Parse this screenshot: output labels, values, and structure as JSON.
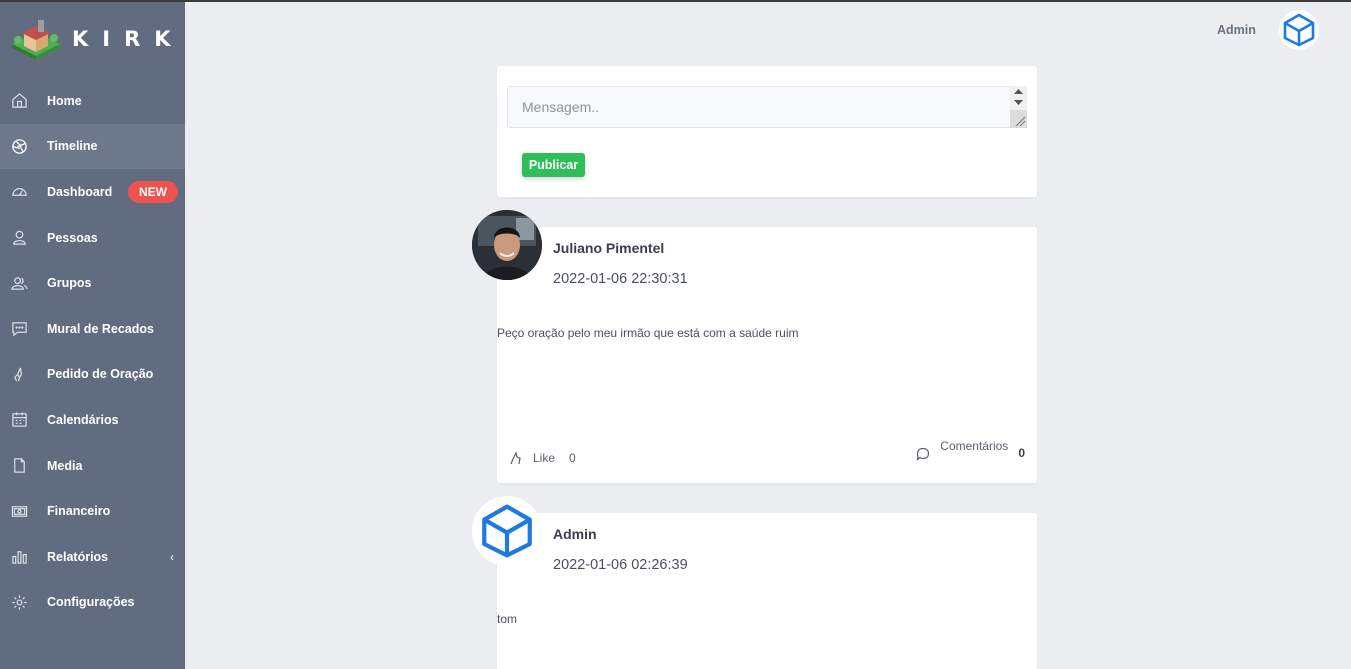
{
  "app": {
    "brand": "KIRK"
  },
  "sidebar": {
    "items": [
      {
        "label": "Home",
        "icon": "home-icon"
      },
      {
        "label": "Timeline",
        "icon": "aperture-icon",
        "active": true
      },
      {
        "label": "Dashboard",
        "icon": "speedometer-icon",
        "badge": "NEW"
      },
      {
        "label": "Pessoas",
        "icon": "user-icon"
      },
      {
        "label": "Grupos",
        "icon": "users-icon"
      },
      {
        "label": "Mural de Recados",
        "icon": "message-icon"
      },
      {
        "label": "Pedido de Oração",
        "icon": "prayer-hands-icon"
      },
      {
        "label": "Calendários",
        "icon": "calendar-icon"
      },
      {
        "label": "Media",
        "icon": "file-icon"
      },
      {
        "label": "Financeiro",
        "icon": "money-icon"
      },
      {
        "label": "Relatórios",
        "icon": "bar-chart-icon",
        "chevron": "‹"
      },
      {
        "label": "Configurações",
        "icon": "gear-icon"
      }
    ]
  },
  "header": {
    "user_name": "Admin"
  },
  "composer": {
    "placeholder": "Mensagem..",
    "publish_label": "Publicar"
  },
  "posts": [
    {
      "author": "Juliano Pimentel",
      "date": "2022-01-06 22:30:31",
      "text": "Peço oração pelo meu irmão que está com a saúde ruim",
      "like_label": "Like",
      "like_count": "0",
      "comments_label": "Comentários",
      "comments_count": "0"
    },
    {
      "author": "Admin",
      "date": "2022-01-06 02:26:39",
      "text": "tom"
    }
  ],
  "colors": {
    "sidebar": "#616c80",
    "accent": "#2fbf5a",
    "badge": "#ef5350",
    "cube": "#1f7ae0"
  }
}
